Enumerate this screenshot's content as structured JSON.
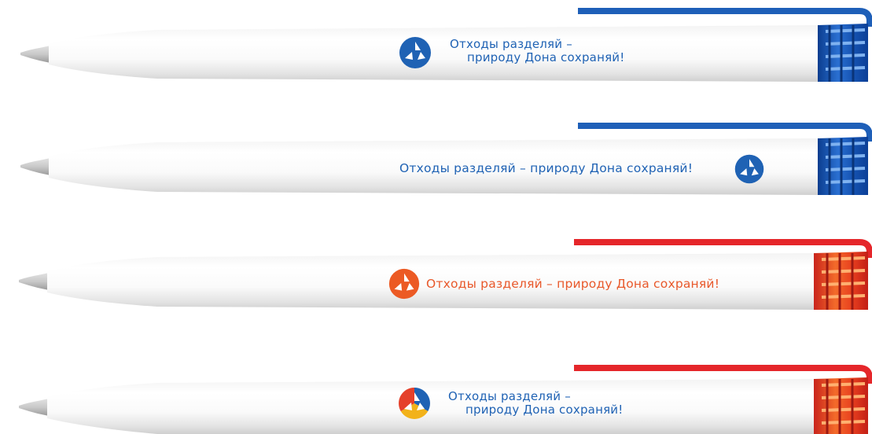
{
  "slogan": {
    "line1": "Отходы разделяй –",
    "line2": "природу Дона сохраняй!",
    "single": "Отходы разделяй – природу Дона сохраняй!"
  },
  "pens": [
    {
      "variant": "blue-two-line",
      "clip_color": "#1e5fb8",
      "text_color": "#1f62b4",
      "logo": "recycle-logo-blue"
    },
    {
      "variant": "blue-one-line",
      "clip_color": "#1e5fb8",
      "text_color": "#1f62b4",
      "logo": "recycle-logo-blue"
    },
    {
      "variant": "red-one-line",
      "clip_color": "#e5262a",
      "text_color": "#e8582a",
      "logo": "recycle-logo-orange"
    },
    {
      "variant": "red-two-line",
      "clip_color": "#e5262a",
      "text_color": "#1f62b4",
      "logo": "recycle-logo-multicolor"
    }
  ]
}
